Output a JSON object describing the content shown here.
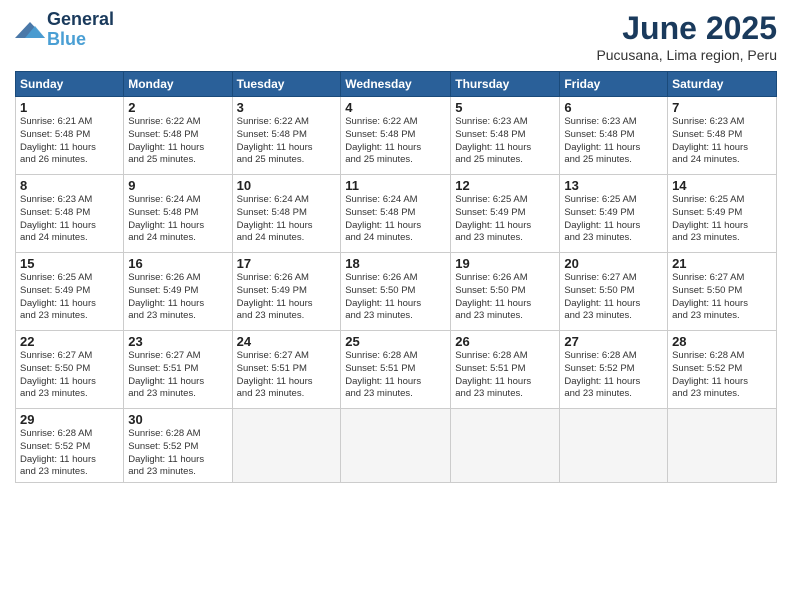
{
  "header": {
    "logo_line1": "General",
    "logo_line2": "Blue",
    "month_title": "June 2025",
    "subtitle": "Pucusana, Lima region, Peru"
  },
  "weekdays": [
    "Sunday",
    "Monday",
    "Tuesday",
    "Wednesday",
    "Thursday",
    "Friday",
    "Saturday"
  ],
  "weeks": [
    [
      {
        "day": "1",
        "info": "Sunrise: 6:21 AM\nSunset: 5:48 PM\nDaylight: 11 hours\nand 26 minutes."
      },
      {
        "day": "2",
        "info": "Sunrise: 6:22 AM\nSunset: 5:48 PM\nDaylight: 11 hours\nand 25 minutes."
      },
      {
        "day": "3",
        "info": "Sunrise: 6:22 AM\nSunset: 5:48 PM\nDaylight: 11 hours\nand 25 minutes."
      },
      {
        "day": "4",
        "info": "Sunrise: 6:22 AM\nSunset: 5:48 PM\nDaylight: 11 hours\nand 25 minutes."
      },
      {
        "day": "5",
        "info": "Sunrise: 6:23 AM\nSunset: 5:48 PM\nDaylight: 11 hours\nand 25 minutes."
      },
      {
        "day": "6",
        "info": "Sunrise: 6:23 AM\nSunset: 5:48 PM\nDaylight: 11 hours\nand 25 minutes."
      },
      {
        "day": "7",
        "info": "Sunrise: 6:23 AM\nSunset: 5:48 PM\nDaylight: 11 hours\nand 24 minutes."
      }
    ],
    [
      {
        "day": "8",
        "info": "Sunrise: 6:23 AM\nSunset: 5:48 PM\nDaylight: 11 hours\nand 24 minutes."
      },
      {
        "day": "9",
        "info": "Sunrise: 6:24 AM\nSunset: 5:48 PM\nDaylight: 11 hours\nand 24 minutes."
      },
      {
        "day": "10",
        "info": "Sunrise: 6:24 AM\nSunset: 5:48 PM\nDaylight: 11 hours\nand 24 minutes."
      },
      {
        "day": "11",
        "info": "Sunrise: 6:24 AM\nSunset: 5:48 PM\nDaylight: 11 hours\nand 24 minutes."
      },
      {
        "day": "12",
        "info": "Sunrise: 6:25 AM\nSunset: 5:49 PM\nDaylight: 11 hours\nand 23 minutes."
      },
      {
        "day": "13",
        "info": "Sunrise: 6:25 AM\nSunset: 5:49 PM\nDaylight: 11 hours\nand 23 minutes."
      },
      {
        "day": "14",
        "info": "Sunrise: 6:25 AM\nSunset: 5:49 PM\nDaylight: 11 hours\nand 23 minutes."
      }
    ],
    [
      {
        "day": "15",
        "info": "Sunrise: 6:25 AM\nSunset: 5:49 PM\nDaylight: 11 hours\nand 23 minutes."
      },
      {
        "day": "16",
        "info": "Sunrise: 6:26 AM\nSunset: 5:49 PM\nDaylight: 11 hours\nand 23 minutes."
      },
      {
        "day": "17",
        "info": "Sunrise: 6:26 AM\nSunset: 5:49 PM\nDaylight: 11 hours\nand 23 minutes."
      },
      {
        "day": "18",
        "info": "Sunrise: 6:26 AM\nSunset: 5:50 PM\nDaylight: 11 hours\nand 23 minutes."
      },
      {
        "day": "19",
        "info": "Sunrise: 6:26 AM\nSunset: 5:50 PM\nDaylight: 11 hours\nand 23 minutes."
      },
      {
        "day": "20",
        "info": "Sunrise: 6:27 AM\nSunset: 5:50 PM\nDaylight: 11 hours\nand 23 minutes."
      },
      {
        "day": "21",
        "info": "Sunrise: 6:27 AM\nSunset: 5:50 PM\nDaylight: 11 hours\nand 23 minutes."
      }
    ],
    [
      {
        "day": "22",
        "info": "Sunrise: 6:27 AM\nSunset: 5:50 PM\nDaylight: 11 hours\nand 23 minutes."
      },
      {
        "day": "23",
        "info": "Sunrise: 6:27 AM\nSunset: 5:51 PM\nDaylight: 11 hours\nand 23 minutes."
      },
      {
        "day": "24",
        "info": "Sunrise: 6:27 AM\nSunset: 5:51 PM\nDaylight: 11 hours\nand 23 minutes."
      },
      {
        "day": "25",
        "info": "Sunrise: 6:28 AM\nSunset: 5:51 PM\nDaylight: 11 hours\nand 23 minutes."
      },
      {
        "day": "26",
        "info": "Sunrise: 6:28 AM\nSunset: 5:51 PM\nDaylight: 11 hours\nand 23 minutes."
      },
      {
        "day": "27",
        "info": "Sunrise: 6:28 AM\nSunset: 5:52 PM\nDaylight: 11 hours\nand 23 minutes."
      },
      {
        "day": "28",
        "info": "Sunrise: 6:28 AM\nSunset: 5:52 PM\nDaylight: 11 hours\nand 23 minutes."
      }
    ],
    [
      {
        "day": "29",
        "info": "Sunrise: 6:28 AM\nSunset: 5:52 PM\nDaylight: 11 hours\nand 23 minutes."
      },
      {
        "day": "30",
        "info": "Sunrise: 6:28 AM\nSunset: 5:52 PM\nDaylight: 11 hours\nand 23 minutes."
      },
      {
        "day": "",
        "info": ""
      },
      {
        "day": "",
        "info": ""
      },
      {
        "day": "",
        "info": ""
      },
      {
        "day": "",
        "info": ""
      },
      {
        "day": "",
        "info": ""
      }
    ]
  ]
}
